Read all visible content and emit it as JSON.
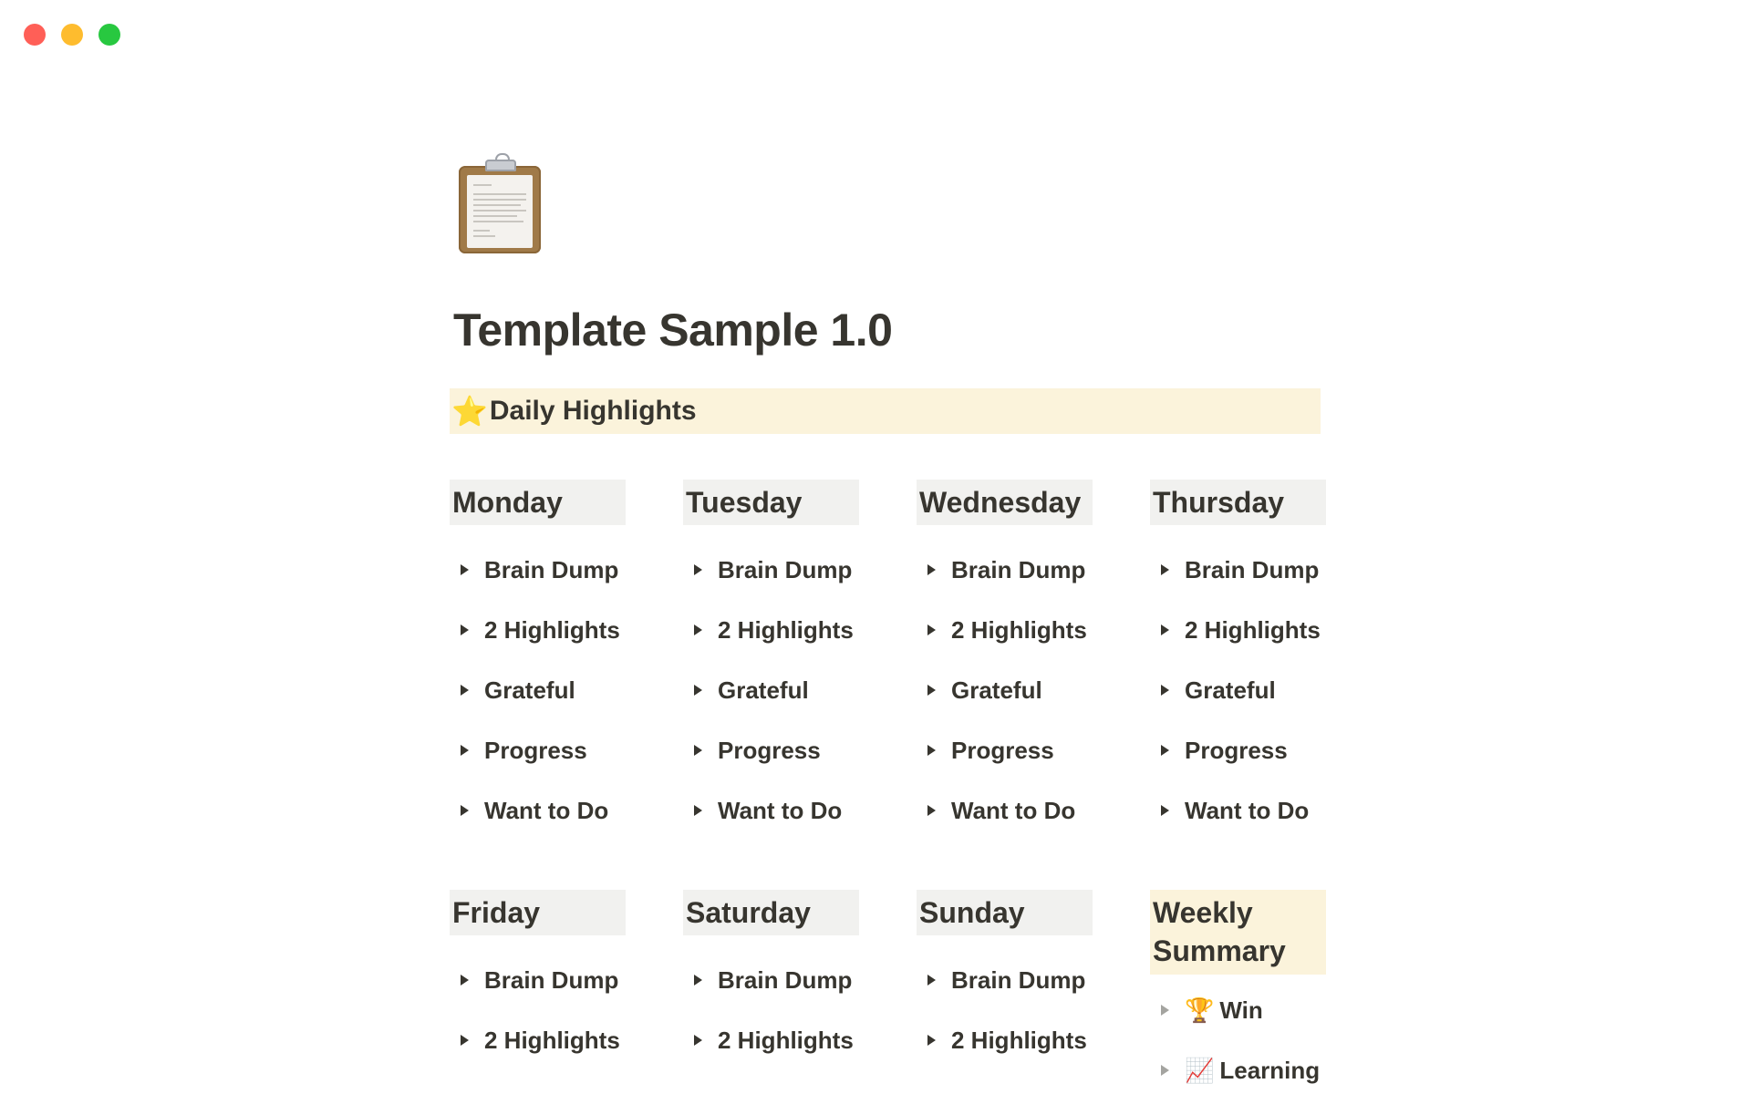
{
  "window": {
    "traffic_lights": {
      "close": "#ff5f57",
      "minimize": "#febc2e",
      "maximize": "#28c840"
    }
  },
  "page": {
    "icon": "clipboard-icon",
    "title": "Template Sample 1.0",
    "callout": {
      "icon": "star-icon",
      "icon_glyph": "⭐",
      "text": "Daily Highlights",
      "background": "#fbf3db"
    },
    "days": [
      {
        "name": "Monday",
        "items": [
          "Brain Dump",
          "2 Highlights",
          "Grateful",
          "Progress",
          "Want to Do"
        ]
      },
      {
        "name": "Tuesday",
        "items": [
          "Brain Dump",
          "2 Highlights",
          "Grateful",
          "Progress",
          "Want to Do"
        ]
      },
      {
        "name": "Wednesday",
        "items": [
          "Brain Dump",
          "2 Highlights",
          "Grateful",
          "Progress",
          "Want to Do"
        ]
      },
      {
        "name": "Thursday",
        "items": [
          "Brain Dump",
          "2 Highlights",
          "Grateful",
          "Progress",
          "Want to Do"
        ]
      },
      {
        "name": "Friday",
        "items": [
          "Brain Dump",
          "2 Highlights"
        ]
      },
      {
        "name": "Saturday",
        "items": [
          "Brain Dump",
          "2 Highlights"
        ]
      },
      {
        "name": "Sunday",
        "items": [
          "Brain Dump",
          "2 Highlights"
        ]
      }
    ],
    "weekly_summary": {
      "title": "Weekly Summary",
      "items": [
        {
          "icon": "trophy-icon",
          "glyph": "🏆",
          "label": "Win"
        },
        {
          "icon": "chart-increasing-icon",
          "glyph": "📈",
          "label": "Learning"
        }
      ]
    }
  }
}
